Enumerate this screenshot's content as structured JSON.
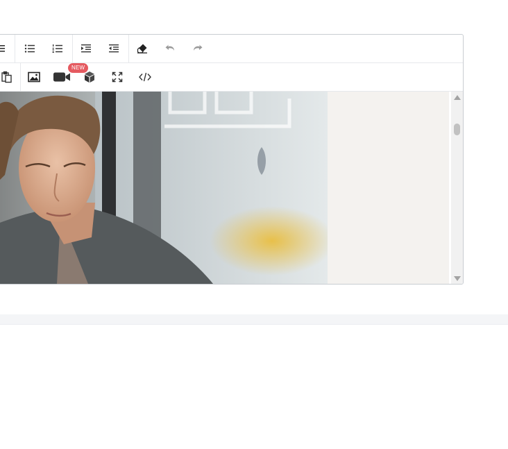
{
  "toolbar": {
    "row1": [
      {
        "icon": "align-justify-icon"
      },
      {
        "icon": "bulleted-list-icon"
      },
      {
        "icon": "numbered-list-icon"
      },
      {
        "icon": "indent-icon"
      },
      {
        "icon": "outdent-icon"
      },
      {
        "icon": "eraser-icon"
      },
      {
        "icon": "undo-icon",
        "disabled": true
      },
      {
        "icon": "redo-icon",
        "disabled": true
      }
    ],
    "row2": [
      {
        "icon": "paste-icon"
      },
      {
        "icon": "image-icon"
      },
      {
        "icon": "video-icon",
        "badge": "NEW"
      },
      {
        "icon": "3d-cube-icon"
      },
      {
        "icon": "fullscreen-icon"
      },
      {
        "icon": "source-code-icon"
      }
    ],
    "video_badge": "NEW"
  },
  "content": {
    "image": "man-reading-in-cafe-photo"
  },
  "colors": {
    "icon": "#333333",
    "icon_disabled": "#9a9a9a",
    "badge": "#e55a60",
    "content_bg": "#f4f2ef",
    "border": "#c9cdd2"
  }
}
